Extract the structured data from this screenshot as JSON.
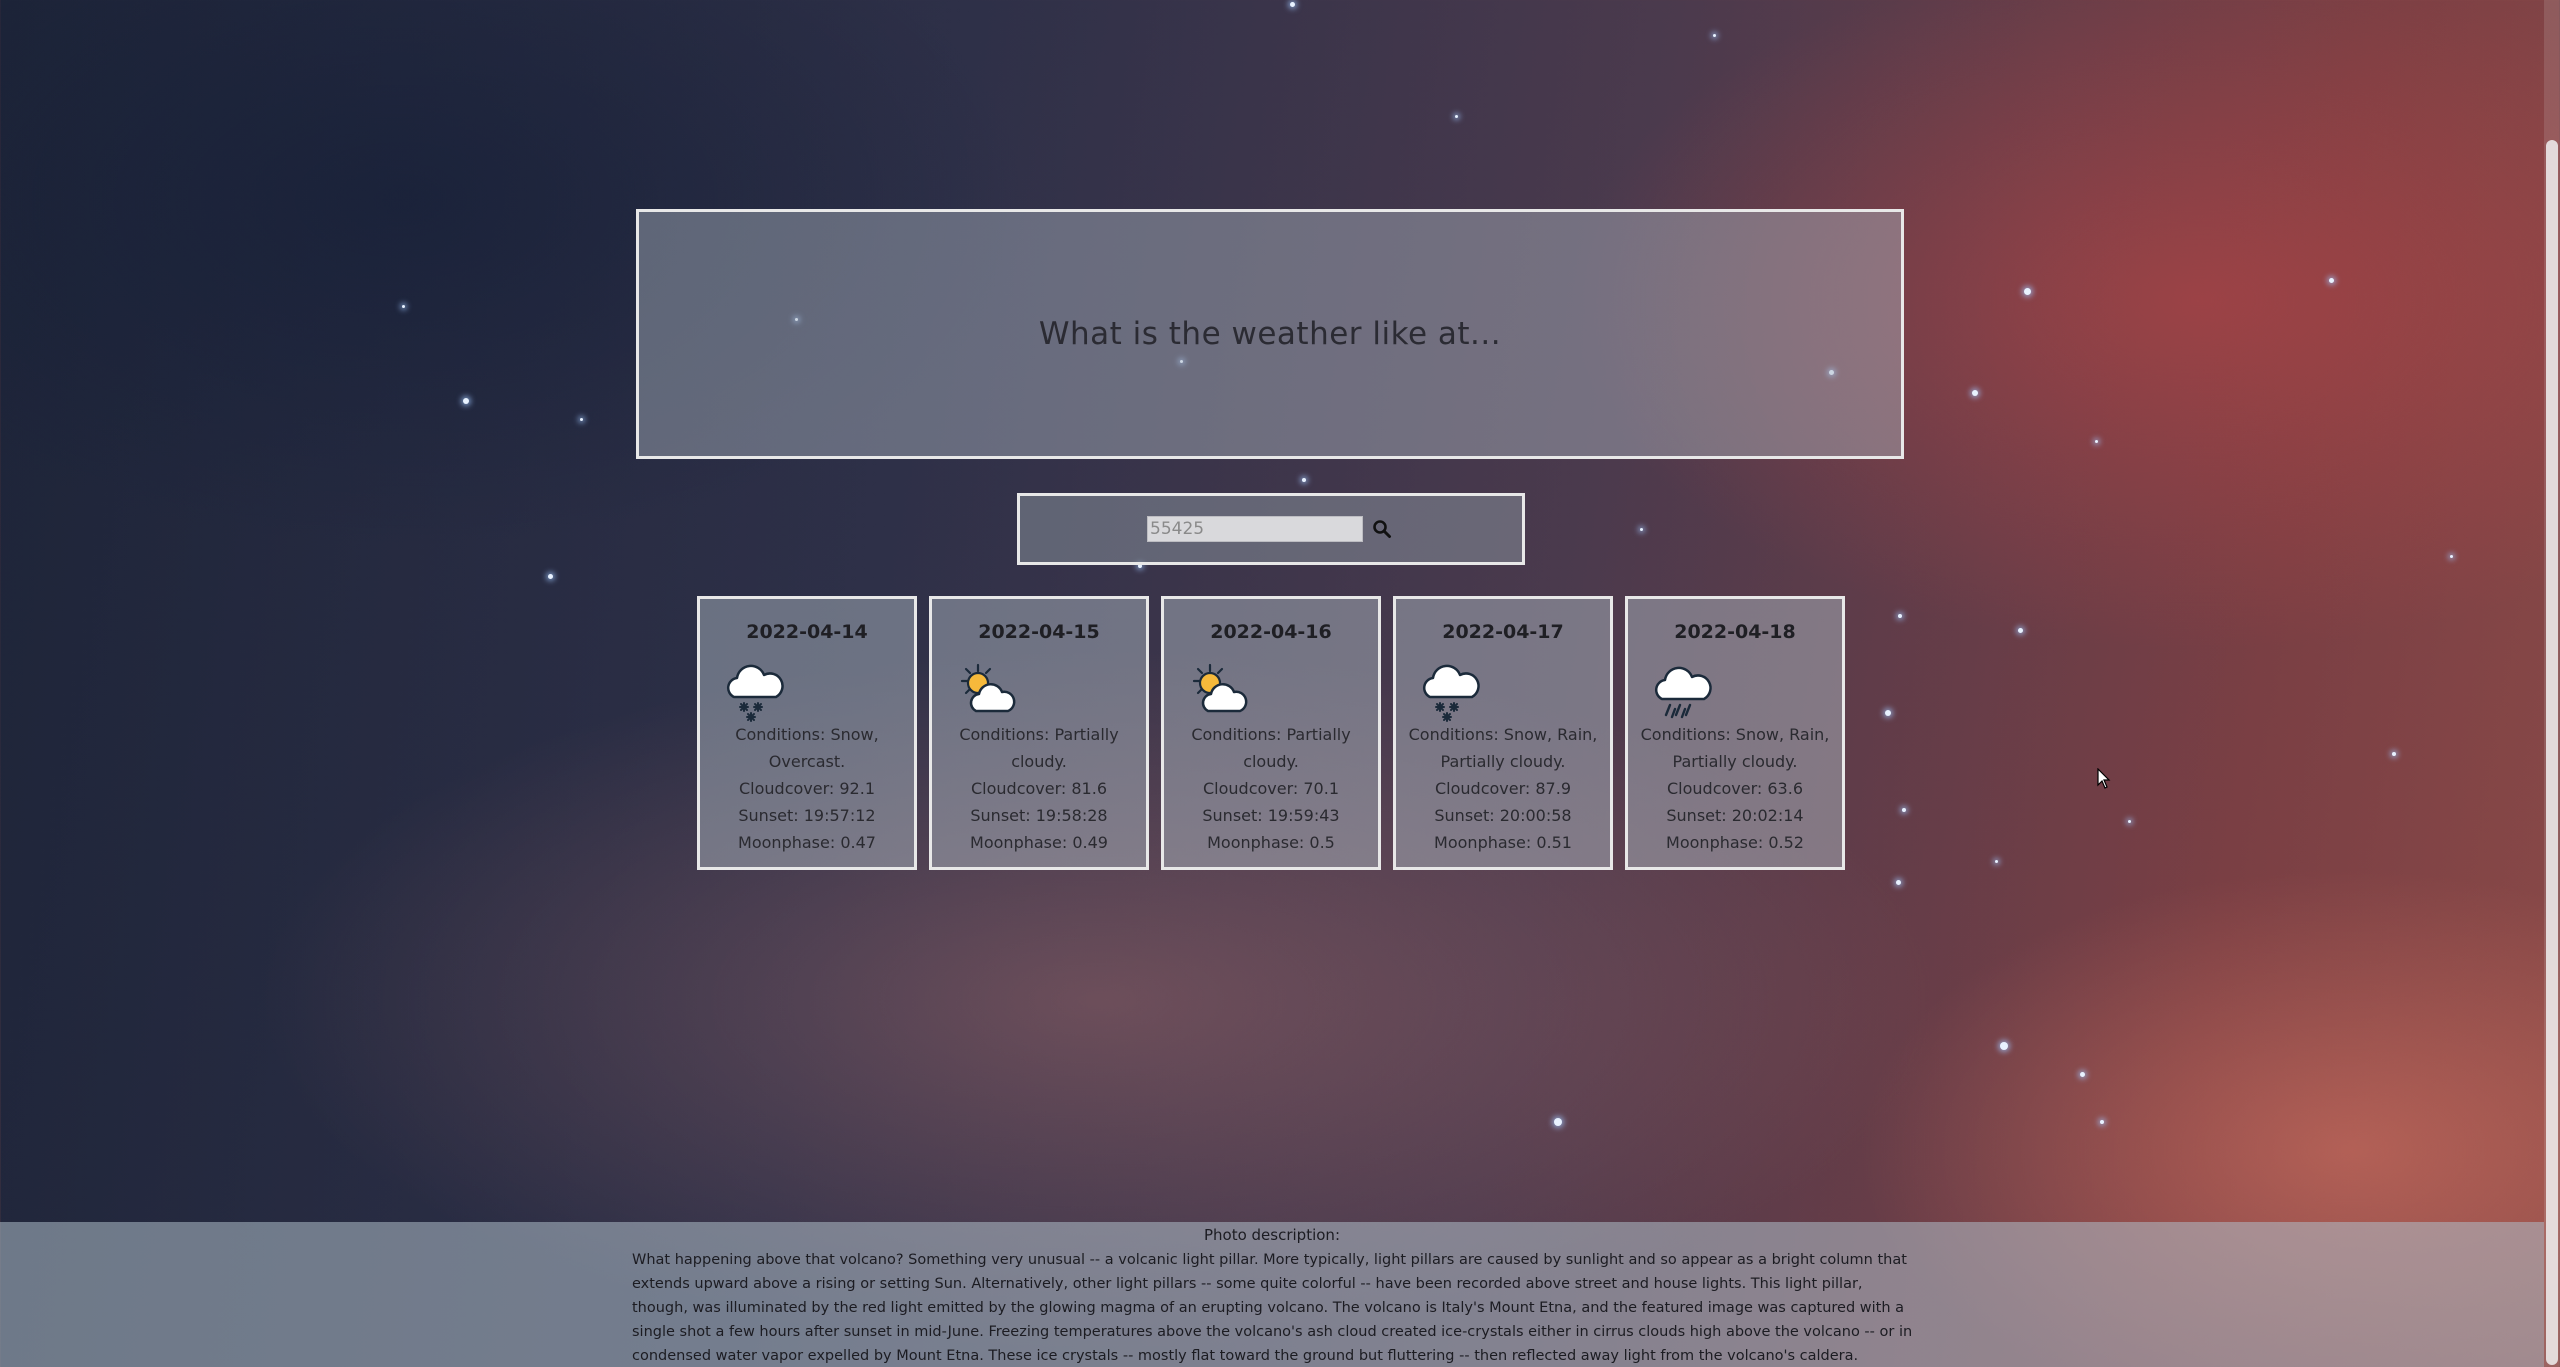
{
  "header": {
    "title": "What is the weather like at..."
  },
  "search": {
    "placeholder": "55425",
    "button_icon": "search-icon"
  },
  "forecast": [
    {
      "date": "2022-04-14",
      "icon": "snow-cloud-icon",
      "conditions": "Conditions: Snow, Overcast.",
      "cloudcover": "Cloudcover: 92.1",
      "sunset": "Sunset: 19:57:12",
      "moonphase": "Moonphase: 0.47"
    },
    {
      "date": "2022-04-15",
      "icon": "partly-cloudy-icon",
      "conditions": "Conditions: Partially cloudy.",
      "cloudcover": "Cloudcover: 81.6",
      "sunset": "Sunset: 19:58:28",
      "moonphase": "Moonphase: 0.49"
    },
    {
      "date": "2022-04-16",
      "icon": "partly-cloudy-icon",
      "conditions": "Conditions: Partially cloudy.",
      "cloudcover": "Cloudcover: 70.1",
      "sunset": "Sunset: 19:59:43",
      "moonphase": "Moonphase: 0.5"
    },
    {
      "date": "2022-04-17",
      "icon": "snow-cloud-icon",
      "conditions": "Conditions: Snow, Rain, Partially cloudy.",
      "cloudcover": "Cloudcover: 87.9",
      "sunset": "Sunset: 20:00:58",
      "moonphase": "Moonphase: 0.51"
    },
    {
      "date": "2022-04-18",
      "icon": "rain-cloud-icon",
      "conditions": "Conditions: Snow, Rain, Partially cloudy.",
      "cloudcover": "Cloudcover: 63.6",
      "sunset": "Sunset: 20:02:14",
      "moonphase": "Moonphase: 0.52"
    }
  ],
  "footer": {
    "title": "Photo description:",
    "description": "What happening above that volcano? Something very unusual -- a volcanic light pillar. More typically, light pillars are caused by sunlight and so appear as a bright column that extends upward above a rising or setting Sun. Alternatively, other light pillars -- some quite colorful -- have been recorded above street and house lights. This light pillar, though, was illuminated by the red light emitted by the glowing magma of an erupting volcano. The volcano is Italy's Mount Etna, and the featured image was captured with a single shot a few hours after sunset in mid-June. Freezing temperatures above the volcano's ash cloud created ice-crystals either in cirrus clouds high above the volcano -- or in condensed water vapor expelled by Mount Etna. These ice crystals -- mostly flat toward the ground but fluttering -- then reflected away light from the volcano's caldera. Explore Your Universe: Random APOD Generator"
  },
  "colors": {
    "panel_border": "#e8e8e8",
    "text_dark": "#2a2a30"
  }
}
